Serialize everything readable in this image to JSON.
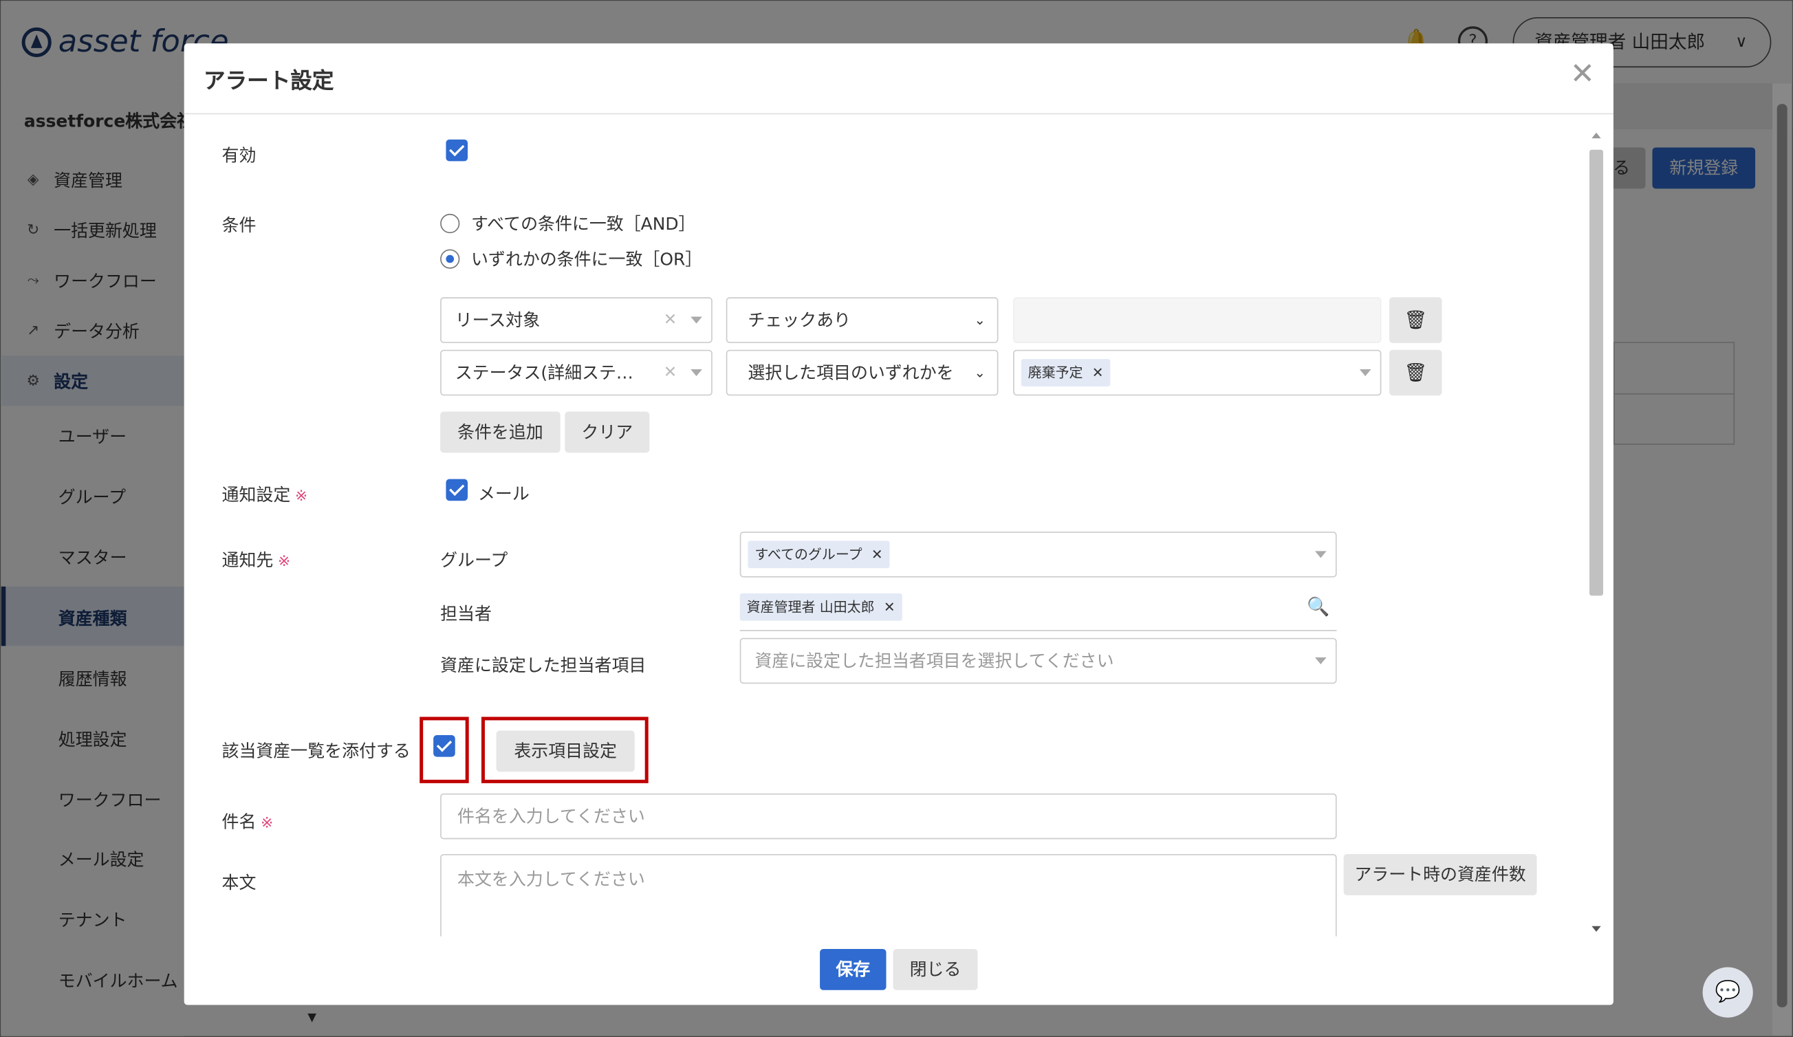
{
  "app": {
    "logo_text": "asset force",
    "user_label": "資産管理者 山田太郎",
    "company": "assetforce株式会社"
  },
  "sidebar": {
    "items": [
      {
        "label": "資産管理",
        "icon": "cube-icon"
      },
      {
        "label": "一括更新処理",
        "icon": "refresh-icon"
      },
      {
        "label": "ワークフロー",
        "icon": "workflow-icon"
      },
      {
        "label": "データ分析",
        "icon": "chart-icon"
      },
      {
        "label": "設定",
        "icon": "gear-icon"
      }
    ],
    "sub_items": [
      "ユーザー",
      "グループ",
      "マスター",
      "資産種類",
      "履歴情報",
      "処理設定",
      "ワークフロー",
      "メール設定",
      "テナント",
      "モバイルホーム"
    ],
    "selected_sub": "資産種類"
  },
  "page": {
    "partial_button": "る",
    "new_button": "新規登録"
  },
  "modal": {
    "title": "アラート設定",
    "enabled_label": "有効",
    "condition_label": "条件",
    "radio_and": "すべての条件に一致［AND］",
    "radio_or": "いずれかの条件に一致［OR］",
    "selected_mode": "OR",
    "conditions": [
      {
        "field": "リース対象",
        "operator": "チェックあり",
        "value": ""
      },
      {
        "field": "ステータス(詳細ステ…",
        "operator": "選択した項目のいずれかを",
        "value_tag": "廃棄予定"
      }
    ],
    "add_condition": "条件を追加",
    "clear": "クリア",
    "notify_label": "通知設定",
    "notify_mail": "メール",
    "required_mark": "※",
    "recipients_label": "通知先",
    "group_label": "グループ",
    "group_tag": "すべてのグループ",
    "person_label": "担当者",
    "person_tag": "資産管理者 山田太郎",
    "asset_person_label": "資産に設定した担当者項目",
    "asset_person_placeholder": "資産に設定した担当者項目を選択してください",
    "attach_label": "該当資産一覧を添付する",
    "display_items_button": "表示項目設定",
    "subject_label": "件名",
    "subject_placeholder": "件名を入力してください",
    "body_label": "本文",
    "body_placeholder": "本文を入力してください",
    "alert_count_button": "アラート時の資産件数",
    "save": "保存",
    "close": "閉じる"
  },
  "colors": {
    "accent": "#2f6bd0",
    "highlight": "#c00000",
    "required": "#e0457b"
  }
}
